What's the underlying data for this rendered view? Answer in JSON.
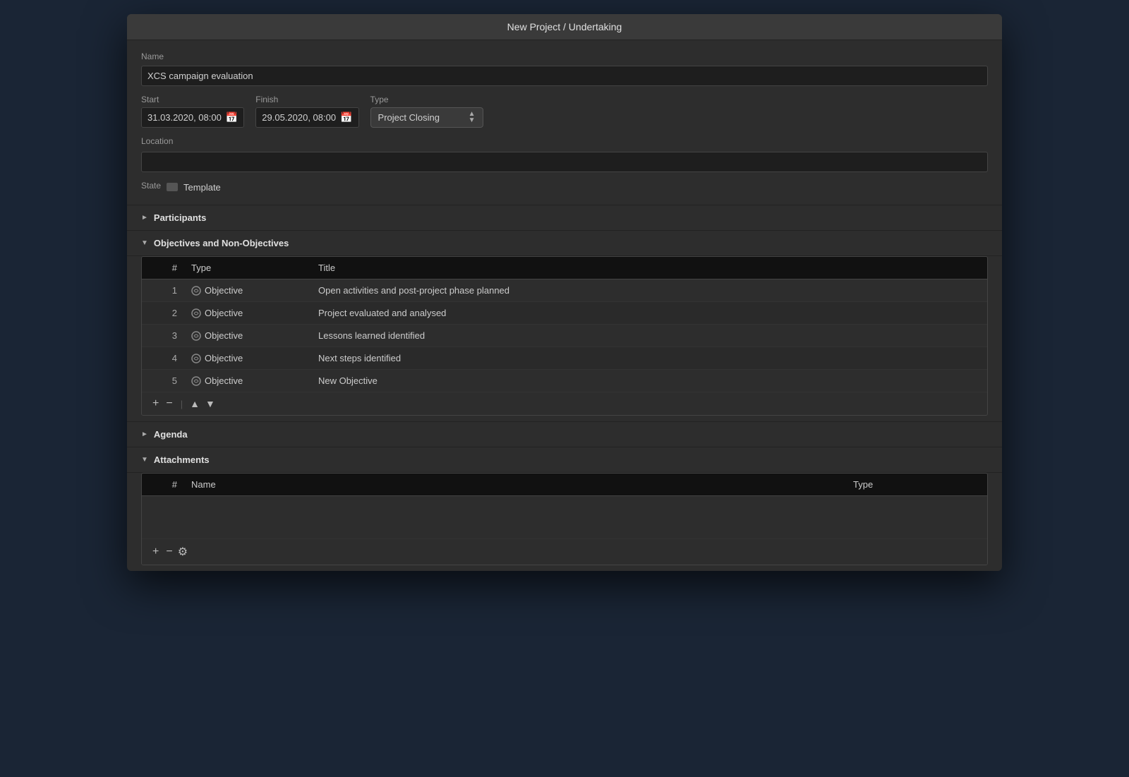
{
  "window": {
    "title": "New Project / Undertaking"
  },
  "form": {
    "name_label": "Name",
    "name_value": "XCS campaign evaluation",
    "start_label": "Start",
    "start_value": "31.03.2020, 08:00",
    "finish_label": "Finish",
    "finish_value": "29.05.2020, 08:00",
    "type_label": "Type",
    "type_value": "Project Closing",
    "location_label": "Location",
    "location_value": "",
    "state_label": "State",
    "state_value": "Template"
  },
  "sections": {
    "participants_label": "Participants",
    "objectives_label": "Objectives and Non-Objectives",
    "agenda_label": "Agenda",
    "attachments_label": "Attachments"
  },
  "objectives_table": {
    "col_num": "#",
    "col_type": "Type",
    "col_title": "Title",
    "rows": [
      {
        "num": "1",
        "type": "Objective",
        "title": "Open activities and post-project phase planned"
      },
      {
        "num": "2",
        "type": "Objective",
        "title": "Project evaluated and analysed"
      },
      {
        "num": "3",
        "type": "Objective",
        "title": "Lessons learned identified"
      },
      {
        "num": "4",
        "type": "Objective",
        "title": "Next steps identified"
      },
      {
        "num": "5",
        "type": "Objective",
        "title": "New Objective"
      }
    ]
  },
  "attachments_table": {
    "col_num": "#",
    "col_name": "Name",
    "col_type": "Type",
    "rows": []
  },
  "toolbar": {
    "add": "+",
    "remove": "−",
    "up": "▲",
    "down": "▼"
  }
}
